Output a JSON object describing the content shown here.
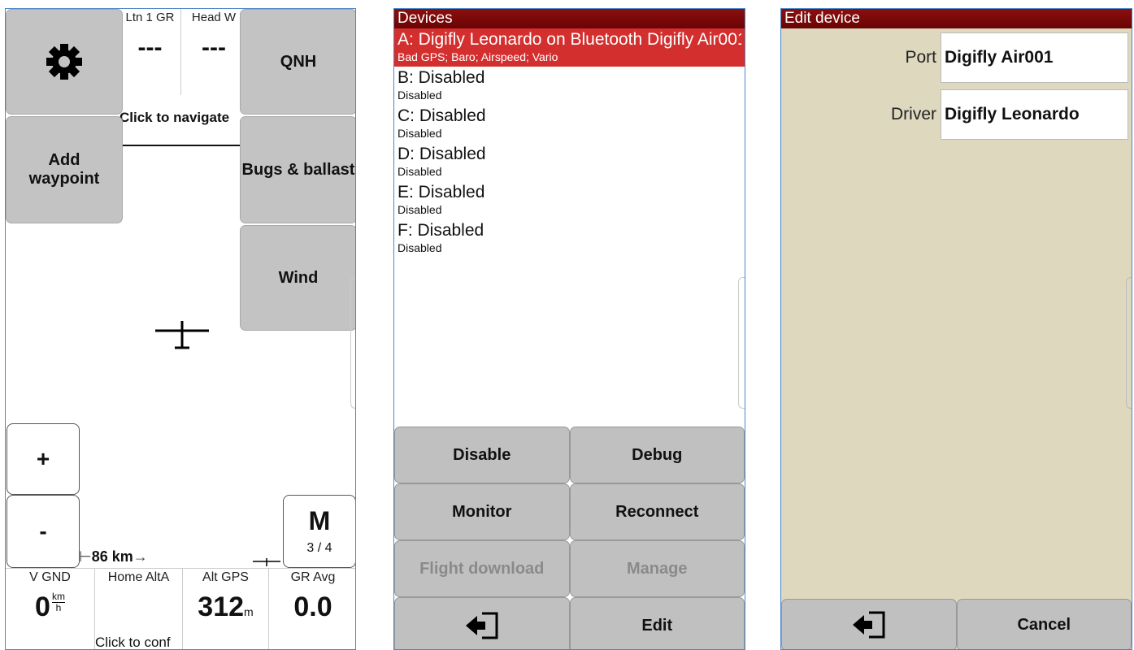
{
  "map_panel": {
    "infoboxes_top": [
      {
        "title": "Ltn 1 GR",
        "value": "---"
      },
      {
        "title": "Head W",
        "value": "---"
      }
    ],
    "navigate_text": "Click to navigate",
    "buttons": {
      "settings_icon": "gear-icon",
      "qnh": "QNH",
      "add_waypoint_line1": "Add",
      "add_waypoint_line2": "waypoint",
      "bugs_ballast": "Bugs & ballast",
      "wind": "Wind",
      "zoom_in": "+",
      "zoom_out": "-",
      "mode": "M",
      "mode_page": "3 / 4"
    },
    "scale": "86 km",
    "infoboxes_bottom": [
      {
        "title": "V GND",
        "value": "0",
        "unit_top": "km",
        "unit_bottom": "h"
      },
      {
        "title": "Home AltA",
        "value": "",
        "note": "Click to conf"
      },
      {
        "title": "Alt GPS",
        "value": "312",
        "unit": "m"
      },
      {
        "title": "GR Avg",
        "value": "0.0"
      }
    ]
  },
  "devices_panel": {
    "title": "Devices",
    "devices": [
      {
        "name": "A: Digifly Leonardo on Bluetooth Digifly Air001",
        "status": "Bad GPS; Baro; Airspeed; Vario",
        "selected": true
      },
      {
        "name": "B: Disabled",
        "status": "Disabled"
      },
      {
        "name": "C: Disabled",
        "status": "Disabled"
      },
      {
        "name": "D: Disabled",
        "status": "Disabled"
      },
      {
        "name": "E: Disabled",
        "status": "Disabled"
      },
      {
        "name": "F: Disabled",
        "status": "Disabled"
      }
    ],
    "buttons": {
      "disable": "Disable",
      "debug": "Debug",
      "monitor": "Monitor",
      "reconnect": "Reconnect",
      "flight_download": "Flight download",
      "manage": "Manage",
      "close_icon": "exit-icon",
      "edit": "Edit"
    },
    "colors": {
      "title_bar": "#7a0a0a",
      "selected": "#d32f2f"
    }
  },
  "edit_panel": {
    "title": "Edit device",
    "fields": {
      "port_label": "Port",
      "port_value": "Digifly Air001",
      "driver_label": "Driver",
      "driver_value": "Digifly Leonardo"
    },
    "buttons": {
      "ok_icon": "exit-icon",
      "cancel": "Cancel"
    },
    "colors": {
      "background": "#ddd8be"
    }
  }
}
